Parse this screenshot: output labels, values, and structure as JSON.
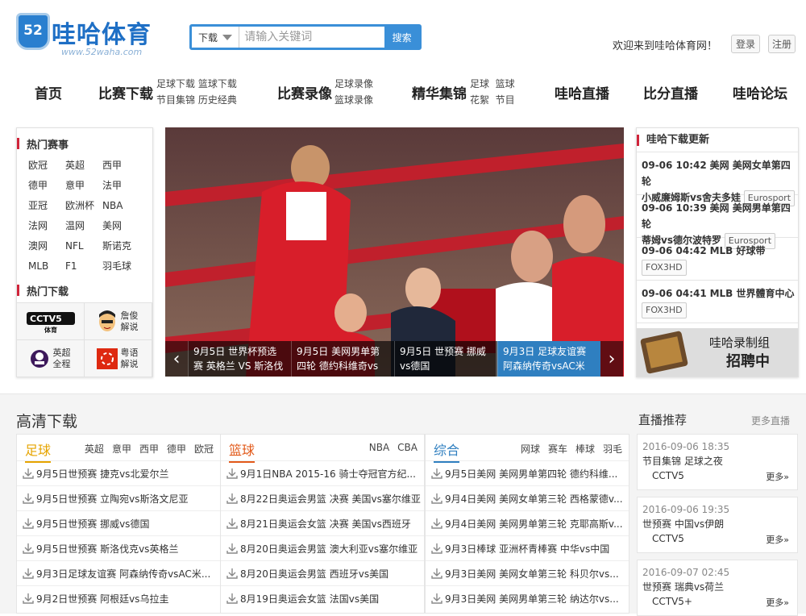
{
  "logo": {
    "badge": "52",
    "name": "哇哈体育",
    "url": "www.52waha.com"
  },
  "search": {
    "type": "下载",
    "placeholder": "请输入关键词",
    "button": "搜索"
  },
  "user": {
    "welcome": "欢迎来到哇哈体育网！",
    "login": "登录",
    "register": "注册"
  },
  "nav": {
    "home": "首页",
    "match_download": "比赛下载",
    "sub1": [
      "足球下载",
      "篮球下载",
      "节目集锦",
      "历史经典"
    ],
    "replay": "比赛录像",
    "sub2": [
      "足球录像",
      "篮球录像"
    ],
    "highlights": "精华集锦",
    "sub3": [
      "足球",
      "篮球",
      "花絮",
      "节目"
    ],
    "live": "哇哈直播",
    "score": "比分直播",
    "forum": "哇哈论坛"
  },
  "hot_events": {
    "title": "热门赛事",
    "items": [
      "欧冠",
      "英超",
      "西甲",
      "德甲",
      "意甲",
      "法甲",
      "亚冠",
      "欧洲杯",
      "NBA",
      "法网",
      "温网",
      "美网",
      "澳网",
      "NFL",
      "斯诺克",
      "MLB",
      "F1",
      "羽毛球"
    ]
  },
  "hot_downloads": {
    "title": "热门下载",
    "items": [
      {
        "icon": "cctv5-logo",
        "label": ""
      },
      {
        "icon": "avatar-icon",
        "label": "詹俊解说"
      },
      {
        "icon": "premier-league-logo",
        "label": "英超全程"
      },
      {
        "icon": "hk-flag-icon",
        "label": "粤语解说"
      }
    ],
    "cctv5_text": "CCTV5",
    "cctv5_sub": "体育"
  },
  "slider": {
    "captions": [
      "9月5日 世界杯预选赛 英格兰 VS 斯洛伐",
      "9月5日 美网男单第四轮 德约科维奇vs",
      "9月5日 世预赛 挪威vs德国",
      "9月3日 足球友谊赛 阿森纳传奇vsAC米"
    ],
    "active": 3
  },
  "updates": {
    "title": "哇哈下载更新",
    "items": [
      {
        "time": "09-06 10:42",
        "event": "美网 美网女单第四轮",
        "match": "小威廉姆斯vs舍夫多娃",
        "tag": "Eurosport"
      },
      {
        "time": "09-06 10:39",
        "event": "美网 美网男单第四轮",
        "match": "蒂姆vs德尔波特罗",
        "tag": "Eurosport"
      },
      {
        "time": "09-06 04:42",
        "event": "MLB 好球带",
        "match": "",
        "tag": "FOX3HD"
      },
      {
        "time": "09-06 04:41",
        "event": "MLB 世界體育中心",
        "match": "",
        "tag": "FOX3HD"
      }
    ],
    "recruit_line1": "哇哈录制组",
    "recruit_line2": "招聘中"
  },
  "hd_download": {
    "title": "高清下载"
  },
  "football": {
    "title": "足球",
    "leagues": [
      "英超",
      "意甲",
      "西甲",
      "德甲",
      "欧冠"
    ],
    "rows": [
      "9月5日世预赛 捷克vs北爱尔兰",
      "9月5日世预赛 立陶宛vs斯洛文尼亚",
      "9月5日世预赛 挪威vs德国",
      "9月5日世预赛 斯洛伐克vs英格兰",
      "9月3日足球友谊赛 阿森纳传奇vsAC米...",
      "9月2日世预赛 阿根廷vs乌拉圭"
    ]
  },
  "basketball": {
    "title": "篮球",
    "leagues": [
      "NBA",
      "CBA"
    ],
    "rows": [
      "9月1日NBA 2015-16 骑士夺冠官方纪...",
      "8月22日奥运会男篮 决赛 美国vs塞尔维亚",
      "8月21日奥运会女篮 决赛 美国vs西班牙",
      "8月20日奥运会男篮 澳大利亚vs塞尔维亚",
      "8月20日奥运会男篮 西班牙vs美国",
      "8月19日奥运会女篮 法国vs美国"
    ]
  },
  "general": {
    "title": "综合",
    "leagues": [
      "网球",
      "赛车",
      "棒球",
      "羽毛"
    ],
    "rows": [
      "9月5日美网 美网男单第四轮 德约科维...",
      "9月4日美网 美网女单第三轮 西格蒙德v...",
      "9月4日美网 美网男单第三轮 克耶高斯v...",
      "9月3日棒球 亚洲杯青棒赛 中华vs中国",
      "9月3日美网 美网女单第三轮 科贝尔vs...",
      "9月3日美网 美网男单第三轮 纳达尔vs..."
    ]
  },
  "live_rec": {
    "title": "直播推荐",
    "more": "更多直播",
    "cards": [
      {
        "time": "2016-09-06 18:35",
        "title": "节目集锦 足球之夜",
        "channel": "CCTV5",
        "more": "更多»"
      },
      {
        "time": "2016-09-06 19:35",
        "title": "世预赛 中国vs伊朗",
        "channel": "CCTV5",
        "more": "更多»"
      },
      {
        "time": "2016-09-07 02:45",
        "title": "世预赛 瑞典vs荷兰",
        "channel": "CCTV5+",
        "more": "更多»"
      }
    ]
  },
  "colors": {
    "brand_blue": "#3a8fd8",
    "accent_red": "#d0243a",
    "football": "#e6a400",
    "basketball": "#e25a1a",
    "general": "#2f7fc0"
  }
}
